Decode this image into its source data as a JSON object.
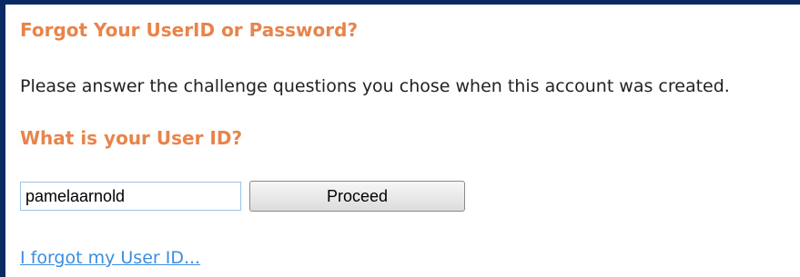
{
  "form": {
    "title": "Forgot Your UserID or Password?",
    "instructions": "Please answer the challenge questions you chose when this account was created.",
    "question": "What is your User ID?",
    "userid_value": "pamelaarnold",
    "proceed_label": "Proceed",
    "forgot_link": "I forgot my User ID..."
  },
  "colors": {
    "heading": "#e8844a",
    "link": "#3b8de0",
    "frame_border": "#0b2a63"
  }
}
